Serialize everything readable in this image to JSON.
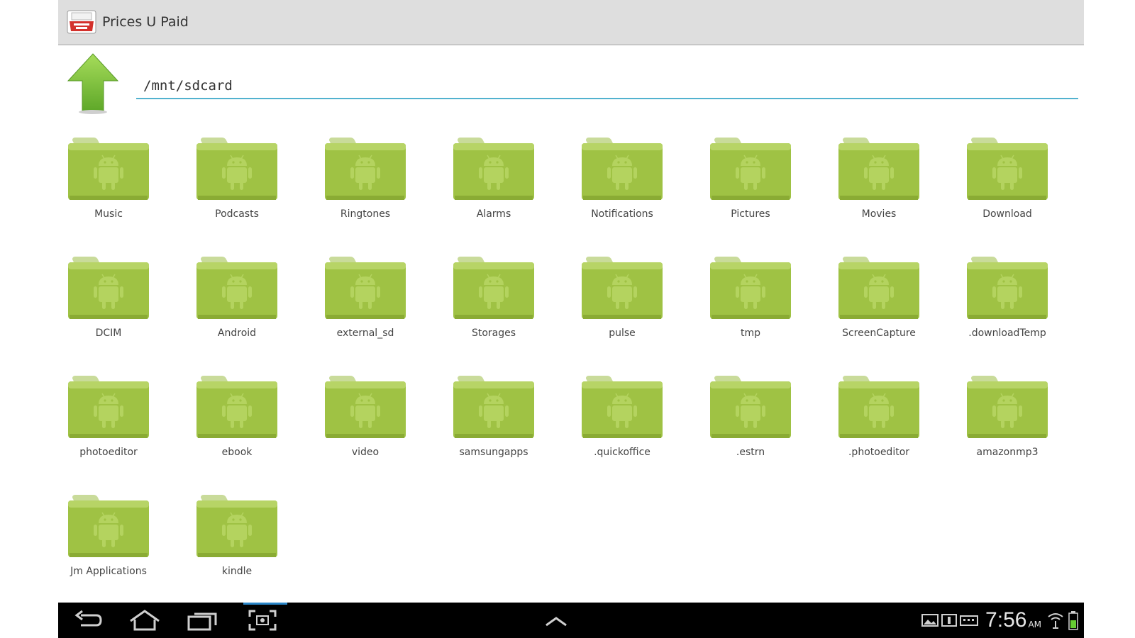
{
  "app": {
    "title": "Prices U Paid",
    "icon": "receipt-app-icon"
  },
  "path_bar": {
    "up_icon": "up-arrow-icon",
    "current_path": "/mnt/sdcard"
  },
  "colors": {
    "folder_green": "#9fc244",
    "path_underline": "#52b2cf",
    "up_arrow": "#7fc43a",
    "title_bar": "#dedede",
    "nav_bar": "#000000"
  },
  "folders": [
    {
      "name": "Music"
    },
    {
      "name": "Podcasts"
    },
    {
      "name": "Ringtones"
    },
    {
      "name": "Alarms"
    },
    {
      "name": "Notifications"
    },
    {
      "name": "Pictures"
    },
    {
      "name": "Movies"
    },
    {
      "name": "Download"
    },
    {
      "name": "DCIM"
    },
    {
      "name": "Android"
    },
    {
      "name": "external_sd"
    },
    {
      "name": "Storages"
    },
    {
      "name": "pulse"
    },
    {
      "name": "tmp"
    },
    {
      "name": "ScreenCapture"
    },
    {
      "name": ".downloadTemp"
    },
    {
      "name": "photoeditor"
    },
    {
      "name": "ebook"
    },
    {
      "name": "video"
    },
    {
      "name": "samsungapps"
    },
    {
      "name": ".quickoffice"
    },
    {
      "name": ".estrn"
    },
    {
      "name": ".photoeditor"
    },
    {
      "name": "amazonmp3"
    },
    {
      "name": "Jm Applications"
    },
    {
      "name": "kindle"
    }
  ],
  "nav_bar": {
    "back_icon": "back-icon",
    "home_icon": "home-icon",
    "recent_apps_icon": "recent-apps-icon",
    "screenshot_icon": "screen-capture-icon",
    "menu_icon": "chevron-up-icon"
  },
  "status": {
    "time": "7:56",
    "ampm": "AM",
    "icons": [
      "gallery-icon",
      "notification-icon",
      "keyboard-icon",
      "wifi-icon",
      "battery-icon"
    ]
  }
}
